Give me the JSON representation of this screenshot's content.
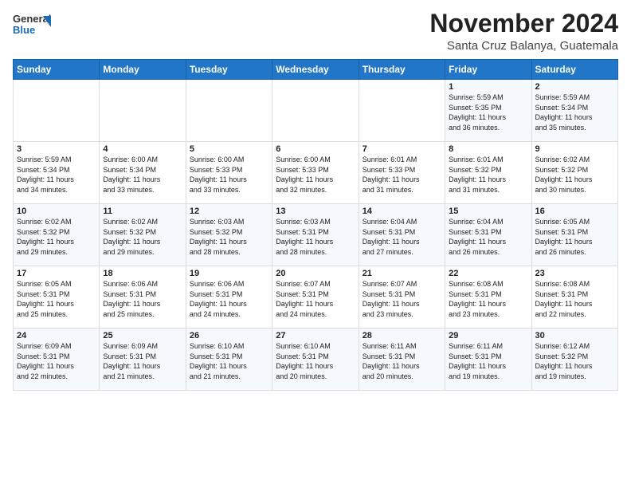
{
  "header": {
    "logo_general": "General",
    "logo_blue": "Blue",
    "month": "November 2024",
    "location": "Santa Cruz Balanya, Guatemala"
  },
  "weekdays": [
    "Sunday",
    "Monday",
    "Tuesday",
    "Wednesday",
    "Thursday",
    "Friday",
    "Saturday"
  ],
  "weeks": [
    [
      {
        "day": "",
        "info": ""
      },
      {
        "day": "",
        "info": ""
      },
      {
        "day": "",
        "info": ""
      },
      {
        "day": "",
        "info": ""
      },
      {
        "day": "",
        "info": ""
      },
      {
        "day": "1",
        "info": "Sunrise: 5:59 AM\nSunset: 5:35 PM\nDaylight: 11 hours\nand 36 minutes."
      },
      {
        "day": "2",
        "info": "Sunrise: 5:59 AM\nSunset: 5:34 PM\nDaylight: 11 hours\nand 35 minutes."
      }
    ],
    [
      {
        "day": "3",
        "info": "Sunrise: 5:59 AM\nSunset: 5:34 PM\nDaylight: 11 hours\nand 34 minutes."
      },
      {
        "day": "4",
        "info": "Sunrise: 6:00 AM\nSunset: 5:34 PM\nDaylight: 11 hours\nand 33 minutes."
      },
      {
        "day": "5",
        "info": "Sunrise: 6:00 AM\nSunset: 5:33 PM\nDaylight: 11 hours\nand 33 minutes."
      },
      {
        "day": "6",
        "info": "Sunrise: 6:00 AM\nSunset: 5:33 PM\nDaylight: 11 hours\nand 32 minutes."
      },
      {
        "day": "7",
        "info": "Sunrise: 6:01 AM\nSunset: 5:33 PM\nDaylight: 11 hours\nand 31 minutes."
      },
      {
        "day": "8",
        "info": "Sunrise: 6:01 AM\nSunset: 5:32 PM\nDaylight: 11 hours\nand 31 minutes."
      },
      {
        "day": "9",
        "info": "Sunrise: 6:02 AM\nSunset: 5:32 PM\nDaylight: 11 hours\nand 30 minutes."
      }
    ],
    [
      {
        "day": "10",
        "info": "Sunrise: 6:02 AM\nSunset: 5:32 PM\nDaylight: 11 hours\nand 29 minutes."
      },
      {
        "day": "11",
        "info": "Sunrise: 6:02 AM\nSunset: 5:32 PM\nDaylight: 11 hours\nand 29 minutes."
      },
      {
        "day": "12",
        "info": "Sunrise: 6:03 AM\nSunset: 5:32 PM\nDaylight: 11 hours\nand 28 minutes."
      },
      {
        "day": "13",
        "info": "Sunrise: 6:03 AM\nSunset: 5:31 PM\nDaylight: 11 hours\nand 28 minutes."
      },
      {
        "day": "14",
        "info": "Sunrise: 6:04 AM\nSunset: 5:31 PM\nDaylight: 11 hours\nand 27 minutes."
      },
      {
        "day": "15",
        "info": "Sunrise: 6:04 AM\nSunset: 5:31 PM\nDaylight: 11 hours\nand 26 minutes."
      },
      {
        "day": "16",
        "info": "Sunrise: 6:05 AM\nSunset: 5:31 PM\nDaylight: 11 hours\nand 26 minutes."
      }
    ],
    [
      {
        "day": "17",
        "info": "Sunrise: 6:05 AM\nSunset: 5:31 PM\nDaylight: 11 hours\nand 25 minutes."
      },
      {
        "day": "18",
        "info": "Sunrise: 6:06 AM\nSunset: 5:31 PM\nDaylight: 11 hours\nand 25 minutes."
      },
      {
        "day": "19",
        "info": "Sunrise: 6:06 AM\nSunset: 5:31 PM\nDaylight: 11 hours\nand 24 minutes."
      },
      {
        "day": "20",
        "info": "Sunrise: 6:07 AM\nSunset: 5:31 PM\nDaylight: 11 hours\nand 24 minutes."
      },
      {
        "day": "21",
        "info": "Sunrise: 6:07 AM\nSunset: 5:31 PM\nDaylight: 11 hours\nand 23 minutes."
      },
      {
        "day": "22",
        "info": "Sunrise: 6:08 AM\nSunset: 5:31 PM\nDaylight: 11 hours\nand 23 minutes."
      },
      {
        "day": "23",
        "info": "Sunrise: 6:08 AM\nSunset: 5:31 PM\nDaylight: 11 hours\nand 22 minutes."
      }
    ],
    [
      {
        "day": "24",
        "info": "Sunrise: 6:09 AM\nSunset: 5:31 PM\nDaylight: 11 hours\nand 22 minutes."
      },
      {
        "day": "25",
        "info": "Sunrise: 6:09 AM\nSunset: 5:31 PM\nDaylight: 11 hours\nand 21 minutes."
      },
      {
        "day": "26",
        "info": "Sunrise: 6:10 AM\nSunset: 5:31 PM\nDaylight: 11 hours\nand 21 minutes."
      },
      {
        "day": "27",
        "info": "Sunrise: 6:10 AM\nSunset: 5:31 PM\nDaylight: 11 hours\nand 20 minutes."
      },
      {
        "day": "28",
        "info": "Sunrise: 6:11 AM\nSunset: 5:31 PM\nDaylight: 11 hours\nand 20 minutes."
      },
      {
        "day": "29",
        "info": "Sunrise: 6:11 AM\nSunset: 5:31 PM\nDaylight: 11 hours\nand 19 minutes."
      },
      {
        "day": "30",
        "info": "Sunrise: 6:12 AM\nSunset: 5:32 PM\nDaylight: 11 hours\nand 19 minutes."
      }
    ]
  ]
}
